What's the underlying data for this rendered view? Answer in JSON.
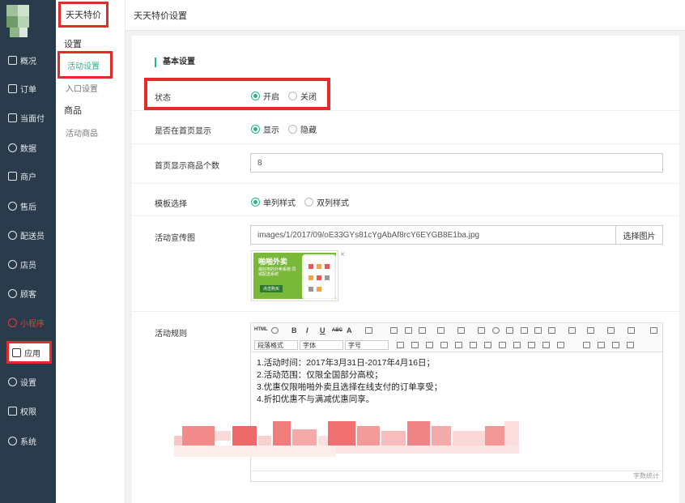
{
  "nav": {
    "items": [
      {
        "label": "概况",
        "icon": "overview-icon"
      },
      {
        "label": "订单",
        "icon": "order-icon"
      },
      {
        "label": "当面付",
        "icon": "face-pay-icon"
      },
      {
        "label": "数据",
        "icon": "data-icon"
      },
      {
        "label": "商户",
        "icon": "merchant-icon"
      },
      {
        "label": "售后",
        "icon": "after-sale-icon"
      },
      {
        "label": "配送员",
        "icon": "courier-icon"
      },
      {
        "label": "店员",
        "icon": "clerk-icon"
      },
      {
        "label": "顾客",
        "icon": "customer-icon"
      },
      {
        "label": "小程序",
        "icon": "mini-program-icon"
      },
      {
        "label": "应用",
        "icon": "apps-icon"
      },
      {
        "label": "设置",
        "icon": "settings-icon"
      },
      {
        "label": "权限",
        "icon": "lock-icon"
      },
      {
        "label": "系统",
        "icon": "system-icon"
      }
    ],
    "highlight_color": "#ef3b3b"
  },
  "subnav": {
    "title": "天天特价",
    "group_settings": "设置",
    "link_activity": "活动设置",
    "link_entry": "入口设置",
    "group_goods": "商品",
    "link_goods": "活动商品"
  },
  "header": {
    "title": "天天特价设置"
  },
  "form": {
    "section": "基本设置",
    "status": {
      "label": "状态",
      "on": "开启",
      "off": "关闭",
      "selected": "开启"
    },
    "homepage": {
      "label": "是否在首页显示",
      "show": "显示",
      "hide": "隐藏",
      "selected": "显示"
    },
    "count": {
      "label": "首页显示商品个数",
      "value": "8"
    },
    "template": {
      "label": "模板选择",
      "single": "单列样式",
      "double": "双列样式",
      "selected": "单列样式"
    },
    "banner": {
      "label": "活动宣传图",
      "path": "images/1/2017/09/oE33GYs81cYgAbAf8rcY6EYGB8E1ba.jpg",
      "button": "选择图片",
      "thumb_title": "啪啪外卖",
      "thumb_sub": "最好用的外卖系统 同城配送系统",
      "thumb_btn": "点击购买",
      "close": "×"
    },
    "rules": {
      "label": "活动规则",
      "toolbar": {
        "html": "HTML",
        "bold": "B",
        "italic": "I",
        "underline": "U",
        "strike": "ABC",
        "font_color": "A",
        "paragraph": "段落格式",
        "font": "字体",
        "size": "字号"
      },
      "lines": [
        "1.活动时间：2017年3月31日-2017年4月16日；",
        "2.活动范围：仅限全国部分高校；",
        "3.优惠仅限啪啪外卖且选择在线支付的订单享受；",
        "4.折扣优惠不与满减优惠同享。"
      ],
      "word_count": "字数统计"
    }
  },
  "colors": {
    "accent": "#26b58e",
    "nav_bg": "#2a3b4c",
    "annotation": "#e52a2a"
  }
}
